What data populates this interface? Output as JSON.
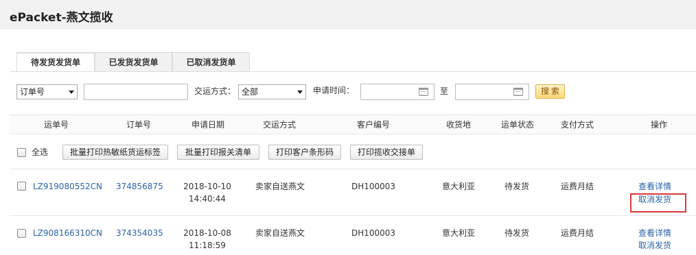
{
  "header": {
    "title": "ePacket-燕文揽收"
  },
  "tabs": [
    {
      "label": "待发货发货单",
      "active": true
    },
    {
      "label": "已发货发货单",
      "active": false
    },
    {
      "label": "已取消发货单",
      "active": false
    }
  ],
  "filter": {
    "order_select": "订单号",
    "order_input": "",
    "delivery_label": "交运方式：",
    "delivery_select": "全部",
    "date_label": "申请时间：",
    "date_from": "",
    "date_sep": "至",
    "date_to": "",
    "search_label": "搜索"
  },
  "table": {
    "columns": [
      "运单号",
      "订单号",
      "申请日期",
      "交运方式",
      "客户编号",
      "收货地",
      "运单状态",
      "支付方式",
      "操作"
    ],
    "select_all_label": "全选",
    "batch_buttons": [
      "批量打印热敏纸货运标签",
      "批量打印报关清单",
      "打印客户条形码",
      "打印揽收交接单"
    ],
    "rows": [
      {
        "waybill": "LZ919080552CN",
        "order": "374856875",
        "date": "2018-10-10",
        "time": "14:40:44",
        "delivery": "卖家自送燕文",
        "customer": "DH100003",
        "destination": "意大利亚",
        "status": "待发货",
        "payment": "运费月结",
        "action_view": "查看详情",
        "action_cancel": "取消发货"
      },
      {
        "waybill": "LZ908166310CN",
        "order": "374354035",
        "date": "2018-10-08",
        "time": "11:18:59",
        "delivery": "卖家自送燕文",
        "customer": "DH100003",
        "destination": "意大利亚",
        "status": "待发货",
        "payment": "运费月结",
        "action_view": "查看详情",
        "action_cancel": "取消发货"
      }
    ]
  },
  "colors": {
    "link": "#2a63a8",
    "tab_accent": "#f0a020",
    "highlight": "#d63a3a",
    "search_button": "#ffd77a"
  }
}
